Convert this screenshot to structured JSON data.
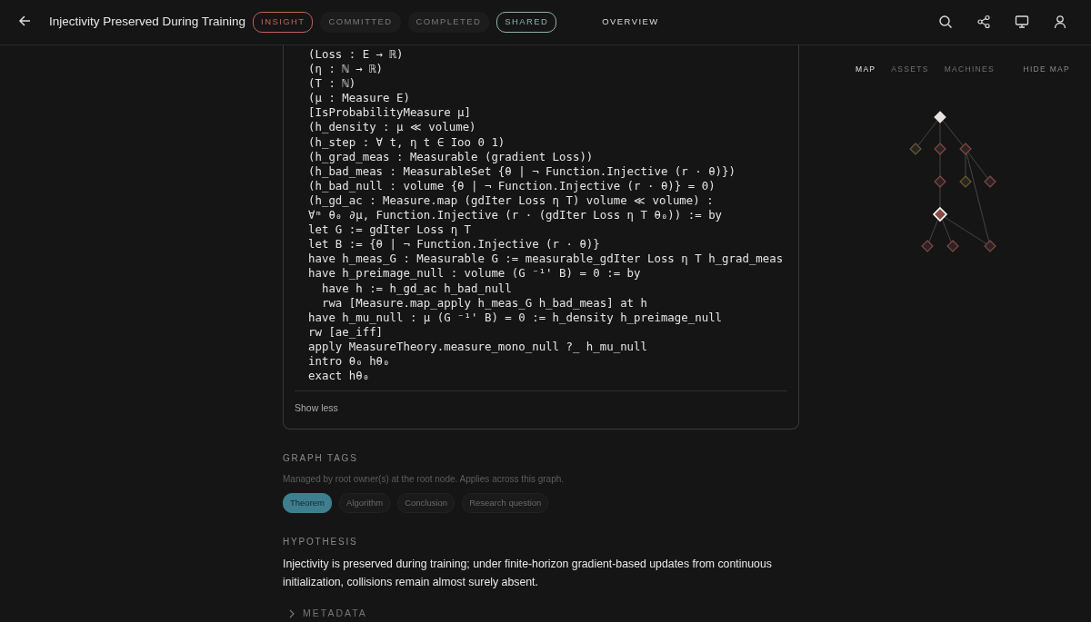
{
  "header": {
    "title": "Injectivity Preserved During Training",
    "statuses": [
      {
        "label": "INSIGHT",
        "active": true,
        "color": "#c0625a"
      },
      {
        "label": "COMMITTED",
        "active": false,
        "color": "#7a7a7a"
      },
      {
        "label": "COMPLETED",
        "active": false,
        "color": "#7a7a7a"
      },
      {
        "label": "SHARED",
        "active": true,
        "color": "#8fb2aa"
      }
    ],
    "nav_link": "OVERVIEW"
  },
  "code": {
    "lines": [
      "(Loss : E → ℝ)",
      "(η : ℕ → ℝ)",
      "(T : ℕ)",
      "(μ : Measure E)",
      "[IsProbabilityMeasure μ]",
      "(h_density : μ ≪ volume)",
      "(h_step : ∀ t, η t ∈ Ioo 0 1)",
      "(h_grad_meas : Measurable (gradient Loss))",
      "(h_bad_meas : MeasurableSet {θ | ¬ Function.Injective (r · θ)})",
      "(h_bad_null : volume {θ | ¬ Function.Injective (r · θ)} = 0)",
      "(h_gd_ac : Measure.map (gdIter Loss η T) volume ≪ volume) :",
      "∀ᵐ θ₀ ∂μ, Function.Injective (r · (gdIter Loss η T θ₀)) := by",
      "let G := gdIter Loss η T",
      "let B := {θ | ¬ Function.Injective (r · θ)}",
      "have h_meas_G : Measurable G := measurable_gdIter Loss η T h_grad_meas",
      "have h_preimage_null : volume (G ⁻¹' B) = 0 := by",
      "  have h := h_gd_ac h_bad_null",
      "  rwa [Measure.map_apply h_meas_G h_bad_meas] at h",
      "have h_mu_null : μ (G ⁻¹' B) = 0 := h_density h_preimage_null",
      "rw [ae_iff]",
      "apply MeasureTheory.measure_mono_null ?_ h_mu_null",
      "intro θ₀ hθ₀",
      "exact hθ₀"
    ],
    "toggle": "Show less"
  },
  "graph_tags": {
    "heading": "GRAPH TAGS",
    "note": "Managed by root owner(s) at the root node. Applies across this graph.",
    "tags": [
      {
        "label": "Theorem",
        "selected": true
      },
      {
        "label": "Algorithm",
        "selected": false
      },
      {
        "label": "Conclusion",
        "selected": false
      },
      {
        "label": "Research question",
        "selected": false
      }
    ]
  },
  "hypothesis": {
    "heading": "HYPOTHESIS",
    "text": "Injectivity is preserved during training; under finite-horizon gradient-based updates from continuous initialization, collisions remain almost surely absent."
  },
  "metadata": {
    "label": "METADATA",
    "expanded": false
  },
  "side_panel": {
    "tabs": [
      {
        "label": "MAP",
        "selected": true
      },
      {
        "label": "ASSETS",
        "selected": false
      },
      {
        "label": "MACHINES",
        "selected": false
      }
    ],
    "hide_button": "HIDE MAP",
    "nodes": [
      {
        "color": "#e8e2e0",
        "selected": false
      },
      {
        "color": "#6b6030",
        "selected": false
      },
      {
        "color": "#8a4a44",
        "selected": false
      },
      {
        "color": "#8a4a44",
        "selected": false
      },
      {
        "color": "#8a4a44",
        "selected": false
      },
      {
        "color": "#6b6030",
        "selected": false
      },
      {
        "color": "#8a4a44",
        "selected": false
      },
      {
        "color": "#8a4a44",
        "selected": true
      },
      {
        "color": "#8a4a44",
        "selected": false
      },
      {
        "color": "#8a4a44",
        "selected": false
      },
      {
        "color": "#8a4a44",
        "selected": false
      }
    ]
  }
}
